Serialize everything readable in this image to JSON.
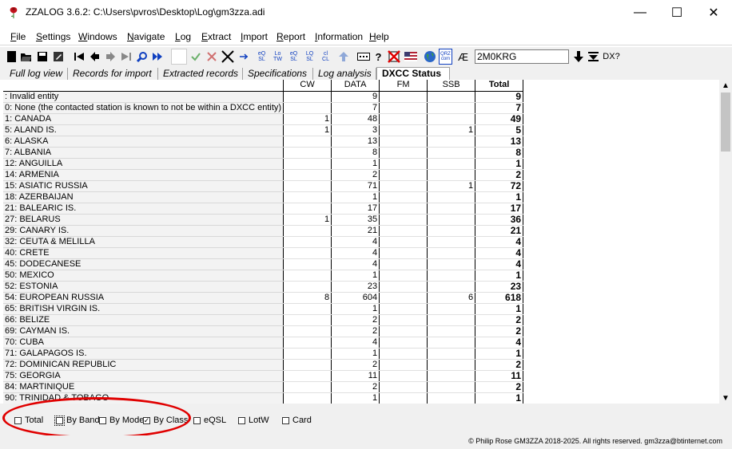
{
  "window": {
    "title": "ZZALOG 3.6.2: C:\\Users\\pvros\\Desktop\\Log\\gm3zza.adi",
    "minimize": "—",
    "maximize": "☐",
    "close": "✕"
  },
  "menu": [
    {
      "label": "File",
      "accel": "F",
      "rest": "ile"
    },
    {
      "label": "Settings",
      "accel": "S",
      "rest": "ettings"
    },
    {
      "label": "Windows",
      "accel": "W",
      "rest": "indows"
    },
    {
      "label": "Navigate",
      "accel": "N",
      "rest": "avigate"
    },
    {
      "label": "Log",
      "accel": "L",
      "rest": "og"
    },
    {
      "label": "Extract",
      "accel": "E",
      "rest": "xtract"
    },
    {
      "label": "Import",
      "accel": "I",
      "rest": "mport"
    },
    {
      "label": "Report",
      "accel": "R",
      "rest": "eport"
    },
    {
      "label": "Information",
      "accel": "I",
      "rest": "nformation"
    },
    {
      "label": "Help",
      "accel": "H",
      "rest": "elp"
    }
  ],
  "toolbar": {
    "callsign_value": "2M0KRG",
    "ae_glyph": "Æ",
    "dx_label": "DX?",
    "question_glyph": "?",
    "icons": [
      "new-file-icon",
      "open-folder-icon",
      "save-icon",
      "save-as-icon",
      "edit-icon",
      "first-record-icon",
      "previous-record-icon",
      "next-record-icon",
      "last-record-icon",
      "find-icon",
      "fast-forward-icon",
      "blank-icon",
      "accept-icon",
      "reject-icon",
      "delete-icon",
      "merge-icon",
      "qsl-eqsl-icon",
      "qsl-lotw-icon",
      "qsl-card-icon",
      "log-qsl-icon",
      "clublog-icon",
      "upload-icon",
      "keyboard-icon",
      "help-icon",
      "no-entry-icon",
      "flag-icon",
      "globe-icon",
      "qrz-icon",
      "ae-icon",
      "down-arrow-icon",
      "sort-icon",
      "dx-icon"
    ]
  },
  "tabs": [
    {
      "label": "Full log view",
      "active": false
    },
    {
      "label": "Records for import",
      "active": false
    },
    {
      "label": "Extracted records",
      "active": false
    },
    {
      "label": "Specifications",
      "active": false
    },
    {
      "label": "Log analysis",
      "active": false
    },
    {
      "label": "DXCC Status",
      "active": true
    }
  ],
  "grid": {
    "columns": [
      "",
      "CW",
      "DATA",
      "FM",
      "SSB",
      "Total"
    ],
    "rows": [
      {
        "entity": ": Invalid entity",
        "cw": "",
        "data": "9",
        "fm": "",
        "ssb": "",
        "total": "9"
      },
      {
        "entity": "0: None (the contacted station is known to not be within a DXCC entity)",
        "cw": "",
        "data": "7",
        "fm": "",
        "ssb": "",
        "total": "7"
      },
      {
        "entity": "1: CANADA",
        "cw": "1",
        "data": "48",
        "fm": "",
        "ssb": "",
        "total": "49"
      },
      {
        "entity": "5: ALAND IS.",
        "cw": "1",
        "data": "3",
        "fm": "",
        "ssb": "1",
        "total": "5"
      },
      {
        "entity": "6: ALASKA",
        "cw": "",
        "data": "13",
        "fm": "",
        "ssb": "",
        "total": "13"
      },
      {
        "entity": "7: ALBANIA",
        "cw": "",
        "data": "8",
        "fm": "",
        "ssb": "",
        "total": "8"
      },
      {
        "entity": "12: ANGUILLA",
        "cw": "",
        "data": "1",
        "fm": "",
        "ssb": "",
        "total": "1"
      },
      {
        "entity": "14: ARMENIA",
        "cw": "",
        "data": "2",
        "fm": "",
        "ssb": "",
        "total": "2"
      },
      {
        "entity": "15: ASIATIC RUSSIA",
        "cw": "",
        "data": "71",
        "fm": "",
        "ssb": "1",
        "total": "72"
      },
      {
        "entity": "18: AZERBAIJAN",
        "cw": "",
        "data": "1",
        "fm": "",
        "ssb": "",
        "total": "1"
      },
      {
        "entity": "21: BALEARIC IS.",
        "cw": "",
        "data": "17",
        "fm": "",
        "ssb": "",
        "total": "17"
      },
      {
        "entity": "27: BELARUS",
        "cw": "1",
        "data": "35",
        "fm": "",
        "ssb": "",
        "total": "36"
      },
      {
        "entity": "29: CANARY IS.",
        "cw": "",
        "data": "21",
        "fm": "",
        "ssb": "",
        "total": "21"
      },
      {
        "entity": "32: CEUTA & MELILLA",
        "cw": "",
        "data": "4",
        "fm": "",
        "ssb": "",
        "total": "4"
      },
      {
        "entity": "40: CRETE",
        "cw": "",
        "data": "4",
        "fm": "",
        "ssb": "",
        "total": "4"
      },
      {
        "entity": "45: DODECANESE",
        "cw": "",
        "data": "4",
        "fm": "",
        "ssb": "",
        "total": "4"
      },
      {
        "entity": "50: MEXICO",
        "cw": "",
        "data": "1",
        "fm": "",
        "ssb": "",
        "total": "1"
      },
      {
        "entity": "52: ESTONIA",
        "cw": "",
        "data": "23",
        "fm": "",
        "ssb": "",
        "total": "23"
      },
      {
        "entity": "54: EUROPEAN RUSSIA",
        "cw": "8",
        "data": "604",
        "fm": "",
        "ssb": "6",
        "total": "618"
      },
      {
        "entity": "65: BRITISH VIRGIN IS.",
        "cw": "",
        "data": "1",
        "fm": "",
        "ssb": "",
        "total": "1"
      },
      {
        "entity": "66: BELIZE",
        "cw": "",
        "data": "2",
        "fm": "",
        "ssb": "",
        "total": "2"
      },
      {
        "entity": "69: CAYMAN IS.",
        "cw": "",
        "data": "2",
        "fm": "",
        "ssb": "",
        "total": "2"
      },
      {
        "entity": "70: CUBA",
        "cw": "",
        "data": "4",
        "fm": "",
        "ssb": "",
        "total": "4"
      },
      {
        "entity": "71: GALAPAGOS IS.",
        "cw": "",
        "data": "1",
        "fm": "",
        "ssb": "",
        "total": "1"
      },
      {
        "entity": "72: DOMINICAN REPUBLIC",
        "cw": "",
        "data": "2",
        "fm": "",
        "ssb": "",
        "total": "2"
      },
      {
        "entity": "75: GEORGIA",
        "cw": "",
        "data": "11",
        "fm": "",
        "ssb": "",
        "total": "11"
      },
      {
        "entity": "84: MARTINIQUE",
        "cw": "",
        "data": "2",
        "fm": "",
        "ssb": "",
        "total": "2"
      },
      {
        "entity": "90: TRINIDAD & TOBAGO",
        "cw": "",
        "data": "1",
        "fm": "",
        "ssb": "",
        "total": "1"
      }
    ]
  },
  "scrollbar": {
    "up": "▲",
    "down": "▼"
  },
  "options": [
    {
      "label": "Total",
      "checked": false
    },
    {
      "label": "By Band",
      "checked": false
    },
    {
      "label": "By Mode",
      "checked": false
    },
    {
      "label": "By Class",
      "checked": true
    },
    {
      "label": "eQSL",
      "checked": false
    },
    {
      "label": "LotW",
      "checked": false
    },
    {
      "label": "Card",
      "checked": false
    }
  ],
  "check_mark": "✓",
  "status": {
    "copyright": "© Philip Rose GM3ZZA 2018-2025. All rights reserved. gm3zza@btinternet.com"
  },
  "colors": {
    "highlight_ellipse": "#e00000",
    "app_icon": "#c0141c"
  }
}
